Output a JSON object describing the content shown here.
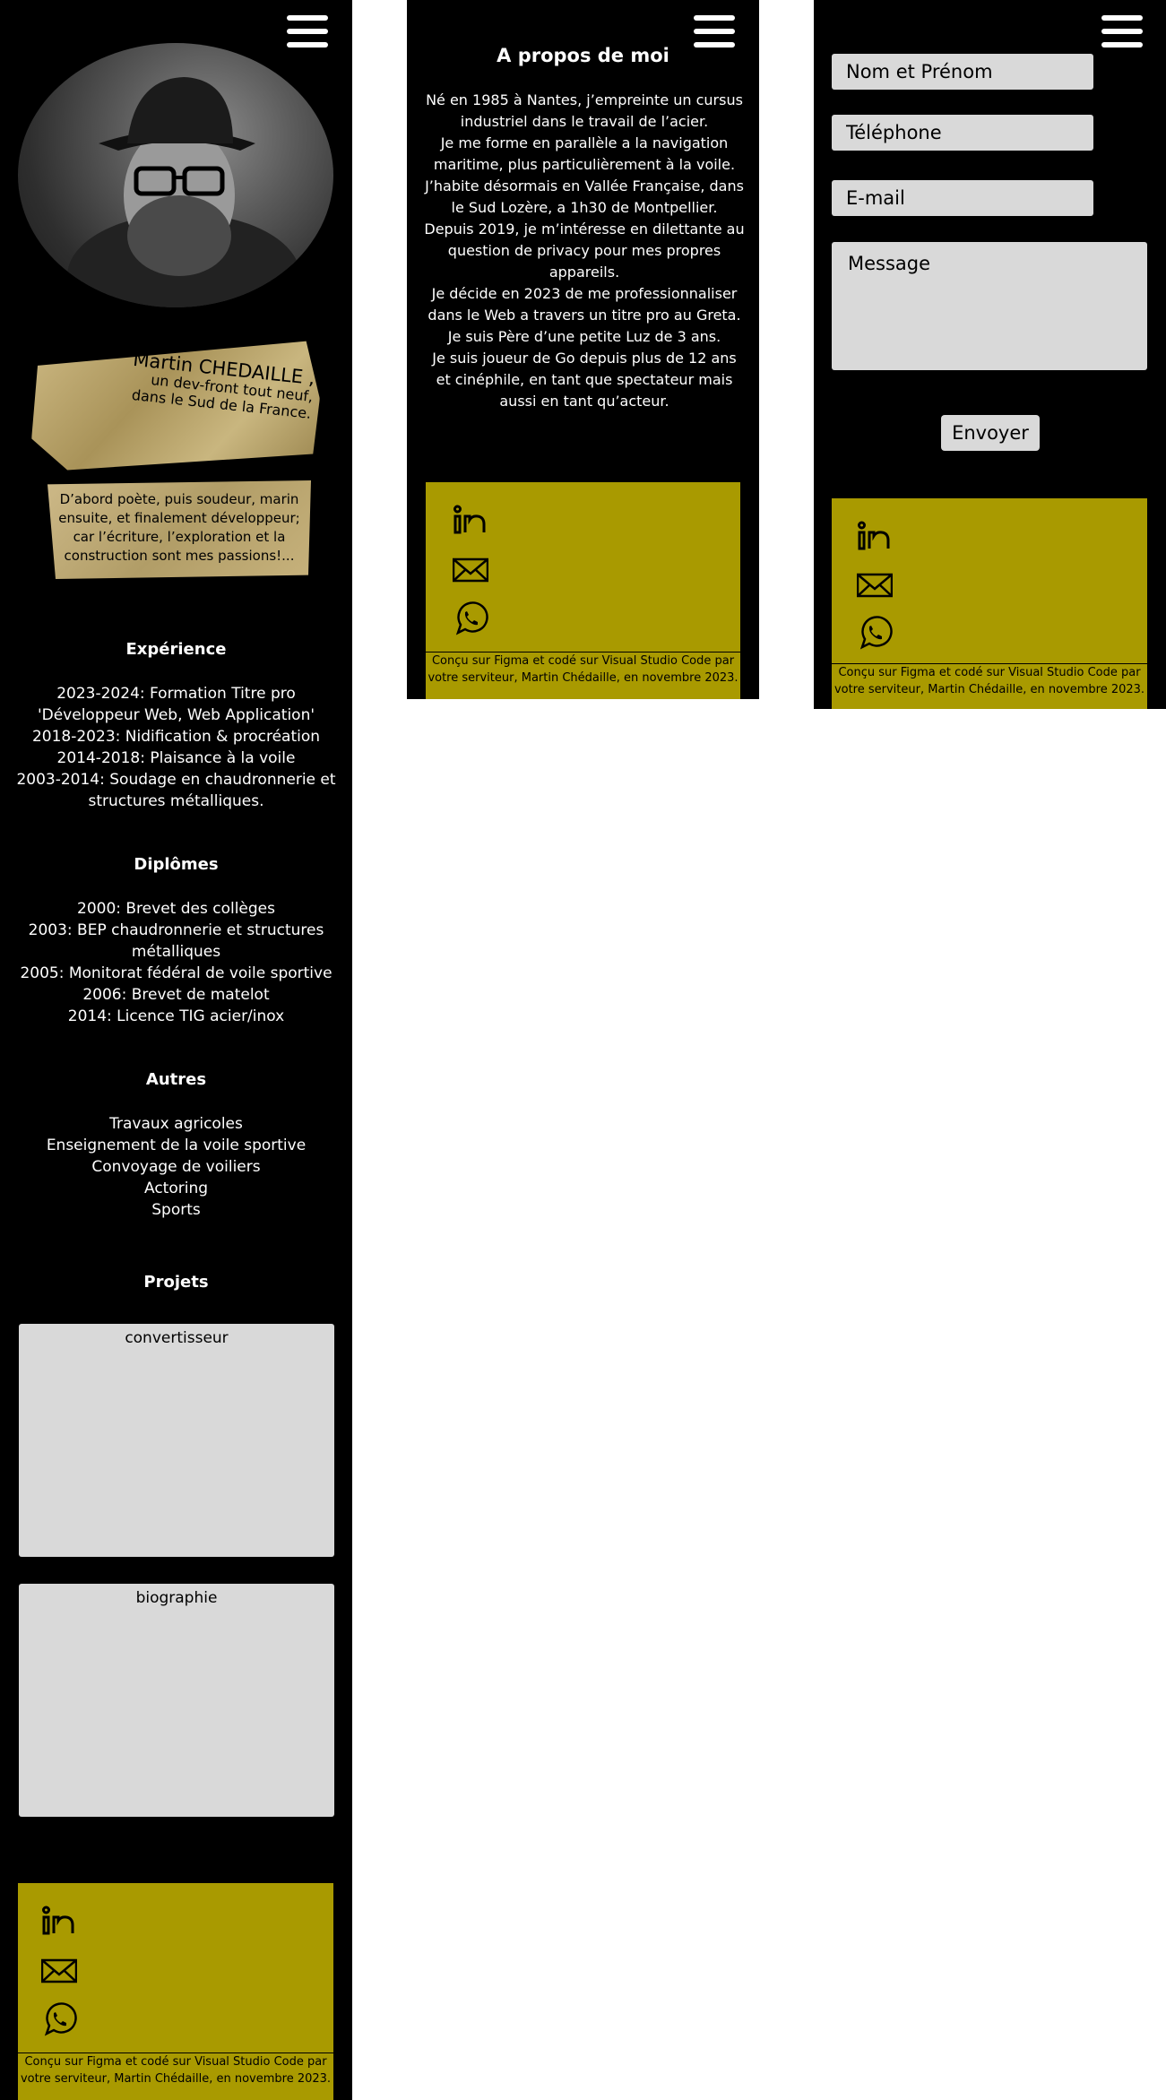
{
  "profile": {
    "name": "Martin CHEDAILLE ,",
    "tagline_1": "un dev-front tout neuf,",
    "tagline_2": "dans le Sud de la France.",
    "intro": "D’abord poète, puis soudeur, marin ensuite, et finalement développeur; car l’écriture, l’exploration et la construction sont mes passions!..."
  },
  "experience": {
    "title": "Expérience",
    "items": [
      "2023-2024:  Formation Titre pro 'Développeur Web, Web Application'",
      "2018-2023:  Nidification & procréation",
      "2014-2018:  Plaisance à la voile",
      "2003-2014:  Soudage en chaudronnerie et structures métalliques."
    ]
  },
  "diplomas": {
    "title": "Diplômes",
    "items": [
      "2000:  Brevet des collèges",
      "2003:  BEP chaudronnerie et structures métalliques",
      "2005:  Monitorat fédéral de voile sportive",
      "2006:  Brevet de matelot",
      "2014:  Licence TIG acier/inox"
    ]
  },
  "others": {
    "title": "Autres",
    "items": [
      "Travaux agricoles",
      "Enseignement de la voile sportive",
      "Convoyage de voiliers",
      "Actoring",
      "Sports"
    ]
  },
  "projects": {
    "title": "Projets",
    "items": [
      "convertisseur",
      "biographie"
    ]
  },
  "about": {
    "title": "A propos de moi",
    "lines": [
      "Né en 1985 à Nantes, j’empreinte un cursus industriel dans le travail de l’acier.",
      "Je me forme en parallèle a la navigation maritime, plus particulièrement à la voile.",
      "J’habite désormais en Vallée Française, dans le Sud Lozère, a 1h30 de Montpellier.",
      "Depuis 2019, je m’intéresse en dilettante au question de privacy pour mes propres appareils.",
      "Je décide en 2023 de me professionnaliser dans le Web a travers un titre pro au Greta.",
      "Je suis Père d’une petite Luz de 3 ans.",
      "Je suis joueur de Go depuis plus de 12 ans et cinéphile, en tant que spectateur mais aussi en tant qu’acteur."
    ]
  },
  "contact": {
    "name_placeholder": "Nom et Prénom",
    "phone_placeholder": "Téléphone",
    "email_placeholder": "E-mail",
    "message_placeholder": "Message",
    "send_label": "Envoyer"
  },
  "footer": {
    "credit": "Conçu sur Figma et codé sur Visual Studio Code par votre serviteur, Martin Chédaille, en novembre 2023.",
    "icons": [
      "linkedin-icon",
      "mail-icon",
      "whatsapp-icon"
    ]
  },
  "colors": {
    "background": "#000000",
    "footer": "#a99a00",
    "field": "#d9d9d9",
    "text": "#ffffff"
  }
}
